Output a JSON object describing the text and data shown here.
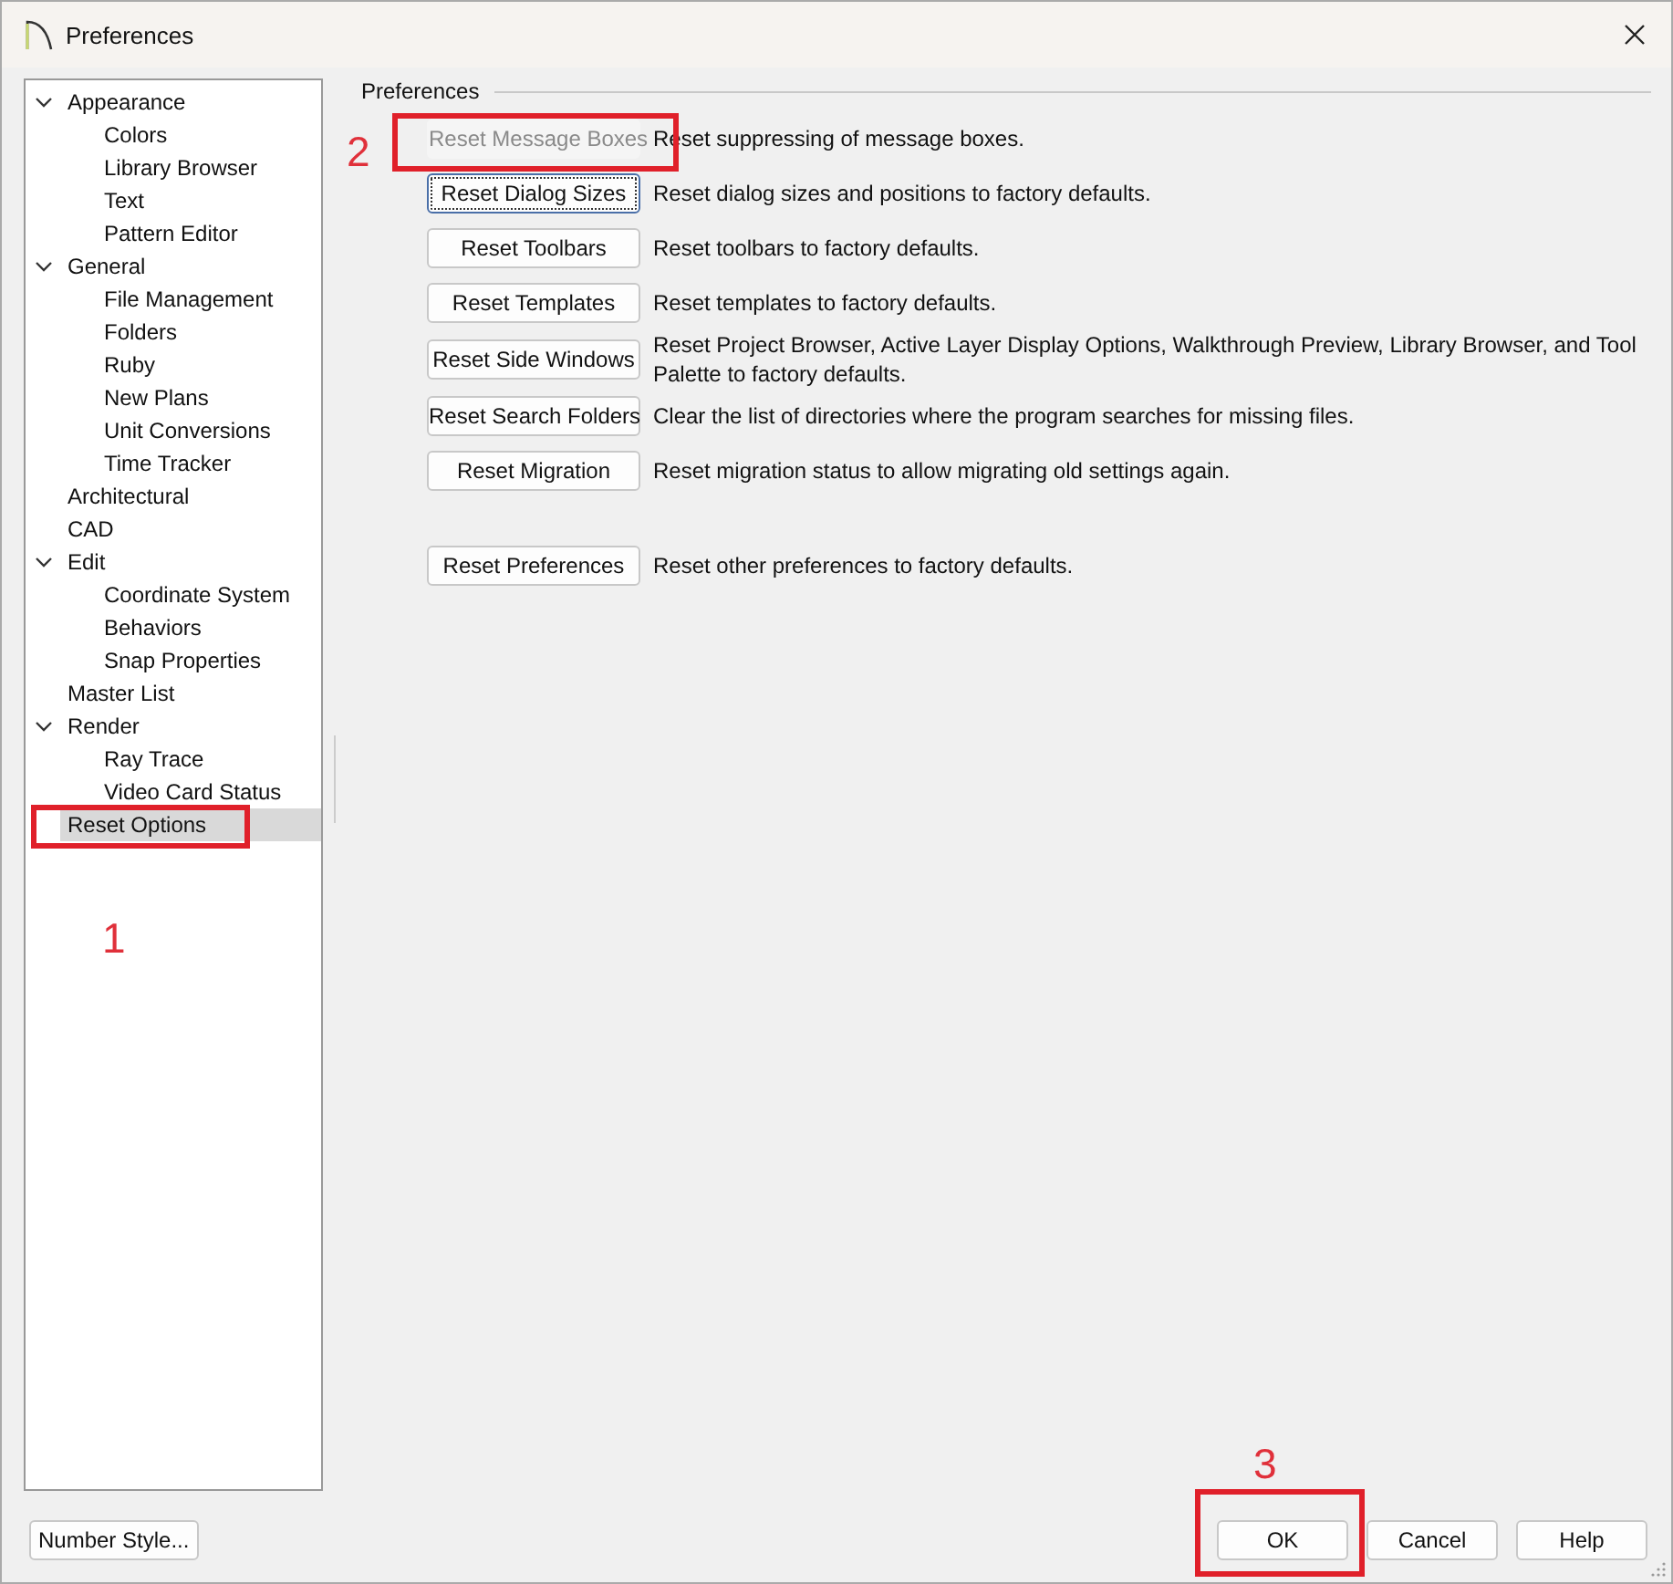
{
  "window": {
    "title": "Preferences"
  },
  "tree": [
    {
      "label": "Appearance",
      "expanded": true,
      "selected": false,
      "children": [
        {
          "label": "Colors",
          "selected": false
        },
        {
          "label": "Library Browser",
          "selected": false
        },
        {
          "label": "Text",
          "selected": false
        },
        {
          "label": "Pattern Editor",
          "selected": false
        }
      ]
    },
    {
      "label": "General",
      "expanded": true,
      "selected": false,
      "children": [
        {
          "label": "File Management",
          "selected": false
        },
        {
          "label": "Folders",
          "selected": false
        },
        {
          "label": "Ruby",
          "selected": false
        },
        {
          "label": "New Plans",
          "selected": false
        },
        {
          "label": "Unit Conversions",
          "selected": false
        },
        {
          "label": "Time Tracker",
          "selected": false
        }
      ]
    },
    {
      "label": "Architectural",
      "selected": false
    },
    {
      "label": "CAD",
      "selected": false
    },
    {
      "label": "Edit",
      "expanded": true,
      "selected": false,
      "children": [
        {
          "label": "Coordinate System",
          "selected": false
        },
        {
          "label": "Behaviors",
          "selected": false
        },
        {
          "label": "Snap Properties",
          "selected": false
        }
      ]
    },
    {
      "label": "Master List",
      "selected": false
    },
    {
      "label": "Render",
      "expanded": true,
      "selected": false,
      "children": [
        {
          "label": "Ray Trace",
          "selected": false
        },
        {
          "label": "Video Card Status",
          "selected": false
        }
      ]
    },
    {
      "label": "Reset Options",
      "selected": true
    }
  ],
  "group": {
    "title": "Preferences",
    "sections": [
      {
        "options": [
          {
            "button": "Reset Message Boxes",
            "description": "Reset suppressing of message boxes.",
            "disabled": true,
            "focused": false
          },
          {
            "button": "Reset Dialog Sizes",
            "description": "Reset dialog sizes and positions to factory defaults.",
            "disabled": false,
            "focused": true
          },
          {
            "button": "Reset Toolbars",
            "description": "Reset toolbars to factory defaults.",
            "disabled": false,
            "focused": false
          },
          {
            "button": "Reset Templates",
            "description": "Reset templates to factory defaults.",
            "disabled": false,
            "focused": false
          },
          {
            "button": "Reset Side Windows",
            "description": "Reset Project Browser, Active Layer Display Options, Walkthrough Preview, Library Browser, and Tool Palette to factory defaults.",
            "disabled": false,
            "focused": false
          },
          {
            "button": "Reset Search Folders",
            "description": "Clear the list of directories where the program searches for missing files.",
            "disabled": false,
            "focused": false
          },
          {
            "button": "Reset Migration",
            "description": "Reset migration status to allow migrating old settings again.",
            "disabled": false,
            "focused": false
          }
        ]
      },
      {
        "options": [
          {
            "button": "Reset Preferences",
            "description": "Reset other preferences to factory defaults.",
            "disabled": false,
            "focused": false
          }
        ]
      }
    ]
  },
  "footer": {
    "left_button": "Number Style...",
    "buttons": [
      "OK",
      "Cancel",
      "Help"
    ]
  },
  "callouts": [
    {
      "number": "1",
      "kind": "tree"
    },
    {
      "number": "2",
      "kind": "option"
    },
    {
      "number": "3",
      "kind": "ok"
    }
  ]
}
